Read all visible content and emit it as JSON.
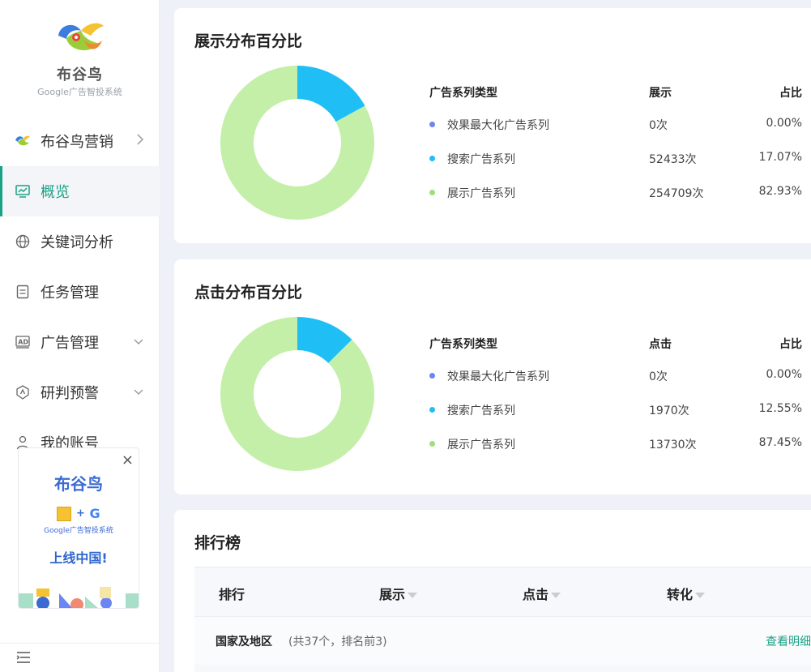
{
  "brand": {
    "title": "布谷鸟",
    "subtitle": "Google广告智投系统"
  },
  "sidebar": {
    "items": [
      {
        "label": "布谷鸟营销",
        "icon": "cuckoo-logo-icon",
        "chevron": "right"
      },
      {
        "label": "概览",
        "icon": "chart-monitor-icon",
        "active": true
      },
      {
        "label": "关键词分析",
        "icon": "globe-icon"
      },
      {
        "label": "任务管理",
        "icon": "document-icon"
      },
      {
        "label": "广告管理",
        "icon": "ad-icon",
        "chevron": "down"
      },
      {
        "label": "研判预警",
        "icon": "alert-shield-icon",
        "chevron": "down"
      },
      {
        "label": "我的账号",
        "icon": "user-icon"
      }
    ]
  },
  "promo": {
    "close": "×",
    "title": "布谷鸟",
    "plus": "+",
    "google_letter": "G",
    "subtitle": "Google广告智投系统",
    "cta": "上线中国!"
  },
  "impressions_card": {
    "title": "展示分布百分比",
    "headers": {
      "type": "广告系列类型",
      "metric": "展示",
      "share": "占比"
    },
    "rows": [
      {
        "name": "效果最大化广告系列",
        "value": "0次",
        "share": "0.00%",
        "color": "#6b86f0"
      },
      {
        "name": "搜索广告系列",
        "value": "52433次",
        "share": "17.07%",
        "color": "#1fbff5"
      },
      {
        "name": "展示广告系列",
        "value": "254709次",
        "share": "82.93%",
        "color": "#9be07a"
      }
    ]
  },
  "clicks_card": {
    "title": "点击分布百分比",
    "headers": {
      "type": "广告系列类型",
      "metric": "点击",
      "share": "占比"
    },
    "rows": [
      {
        "name": "效果最大化广告系列",
        "value": "0次",
        "share": "0.00%",
        "color": "#6b86f0"
      },
      {
        "name": "搜索广告系列",
        "value": "1970次",
        "share": "12.55%",
        "color": "#1fbff5"
      },
      {
        "name": "展示广告系列",
        "value": "13730次",
        "share": "87.45%",
        "color": "#9be07a"
      }
    ]
  },
  "ranking_card": {
    "title": "排行榜",
    "columns": [
      "排行",
      "展示",
      "点击",
      "转化"
    ],
    "group": {
      "label": "国家及地区",
      "meta": "(共37个，排名前3)",
      "link": "查看明细"
    }
  },
  "colors": {
    "accent": "#1aa185",
    "donut_segment_search": "#1fbff5",
    "donut_segment_display": "#c4efa9"
  },
  "chart_data": [
    {
      "type": "pie",
      "title": "展示分布百分比",
      "categories": [
        "效果最大化广告系列",
        "搜索广告系列",
        "展示广告系列"
      ],
      "values": [
        0,
        17.07,
        82.93
      ]
    },
    {
      "type": "pie",
      "title": "点击分布百分比",
      "categories": [
        "效果最大化广告系列",
        "搜索广告系列",
        "展示广告系列"
      ],
      "values": [
        0,
        12.55,
        87.45
      ]
    }
  ]
}
